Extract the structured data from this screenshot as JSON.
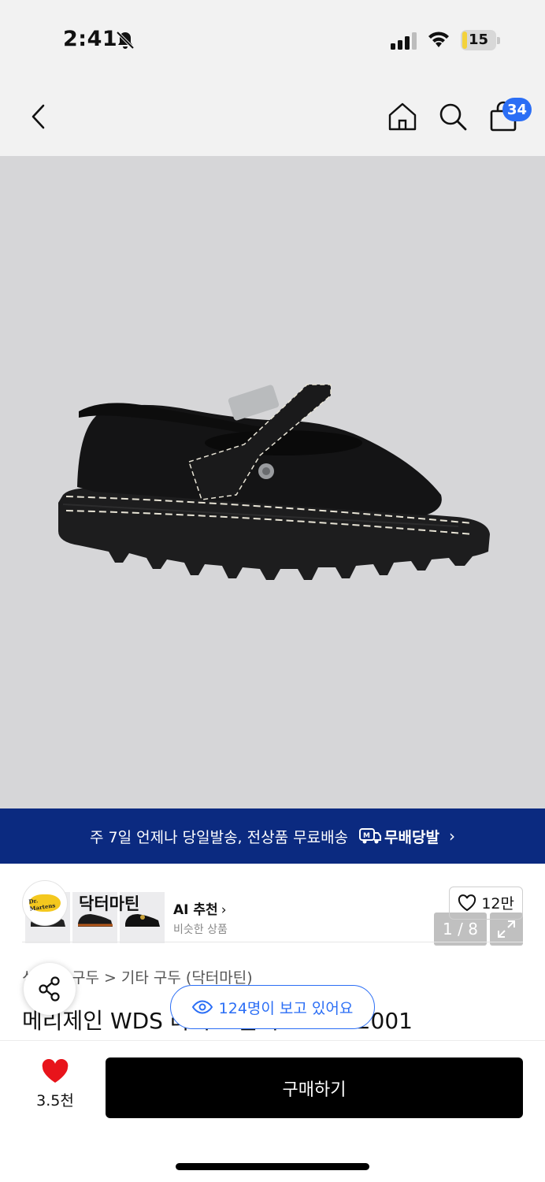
{
  "status_bar": {
    "time": "2:41",
    "battery_level": 15,
    "battery_text": "15"
  },
  "nav": {
    "cart_count": "34"
  },
  "gallery": {
    "ai_title": "AI 추천",
    "ai_subtitle": "비슷한 상품",
    "page_indicator": "1 / 8"
  },
  "banner": {
    "text": "주 7일 언제나 당일발송, 전상품 무료배송",
    "logo_text": "무배당발"
  },
  "brand": {
    "name": "닥터마틴",
    "logo_text": "Dr. Martens",
    "likes": "12만"
  },
  "product": {
    "breadcrumb": "신발 > 구두 > 기타 구두 (닥터마틴)",
    "title": "메리제인 WDS 라이트 블랙 - 31562001",
    "viewers_text": "124명이 보고 있어요"
  },
  "bottom": {
    "heart_count": "3.5천",
    "buy_label": "구매하기"
  },
  "colors": {
    "accent": "#2b6ef5",
    "banner": "#0b2a80",
    "heart": "#e8141b",
    "buy_button": "#000000"
  }
}
